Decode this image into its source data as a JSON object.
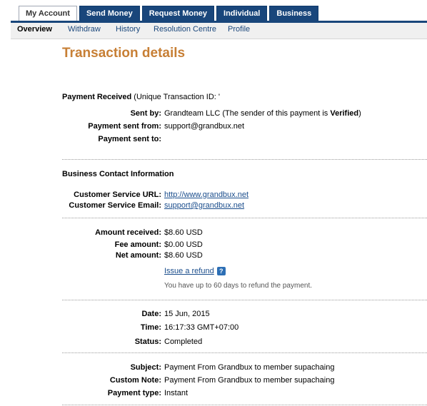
{
  "tabs": [
    {
      "label": "My Account"
    },
    {
      "label": "Send Money"
    },
    {
      "label": "Request Money"
    },
    {
      "label": "Individual"
    },
    {
      "label": "Business"
    }
  ],
  "subnav": [
    {
      "label": "Overview"
    },
    {
      "label": "Withdraw"
    },
    {
      "label": "History"
    },
    {
      "label": "Resolution Centre"
    },
    {
      "label": "Profile"
    }
  ],
  "page_title": "Transaction details",
  "payment": {
    "heading": "Payment Received",
    "unique_id_label": "(Unique Transaction ID: '",
    "sent_by_label": "Sent by:",
    "sent_by_value": "Grandteam LLC (The sender of this payment is ",
    "verified": "Verified",
    "sent_by_tail": ")",
    "sent_from_label": "Payment sent from:",
    "sent_from_value": "support@grandbux.net",
    "sent_to_label": "Payment sent to:"
  },
  "business": {
    "heading": "Business Contact Information",
    "url_label": "Customer Service URL:",
    "url_value": "http://www.grandbux.net",
    "email_label": "Customer Service Email:",
    "email_value": "support@grandbux.net"
  },
  "amounts": {
    "received_label": "Amount received:",
    "received_value": "$8.60 USD",
    "fee_label": "Fee amount:",
    "fee_value": "$0.00 USD",
    "net_label": "Net amount:",
    "net_value": "$8.60 USD",
    "refund_link": "Issue a refund",
    "refund_note": "You have up to 60 days to refund the payment."
  },
  "timing": {
    "date_label": "Date:",
    "date_value": "15 Jun, 2015",
    "time_label": "Time:",
    "time_value": "16:17:33 GMT+07:00",
    "status_label": "Status:",
    "status_value": "Completed"
  },
  "details": {
    "subject_label": "Subject:",
    "subject_value": "Payment From Grandbux to member supachaing",
    "note_label": "Custom Note:",
    "note_value": "Payment From Grandbux to member supachaing",
    "type_label": "Payment type:",
    "type_value": "Instant"
  },
  "icons": {
    "help": "help-question-icon"
  },
  "colors": {
    "brand_blue": "#19467b",
    "title_orange": "#c77f35",
    "link_blue": "#1a4d8c"
  }
}
